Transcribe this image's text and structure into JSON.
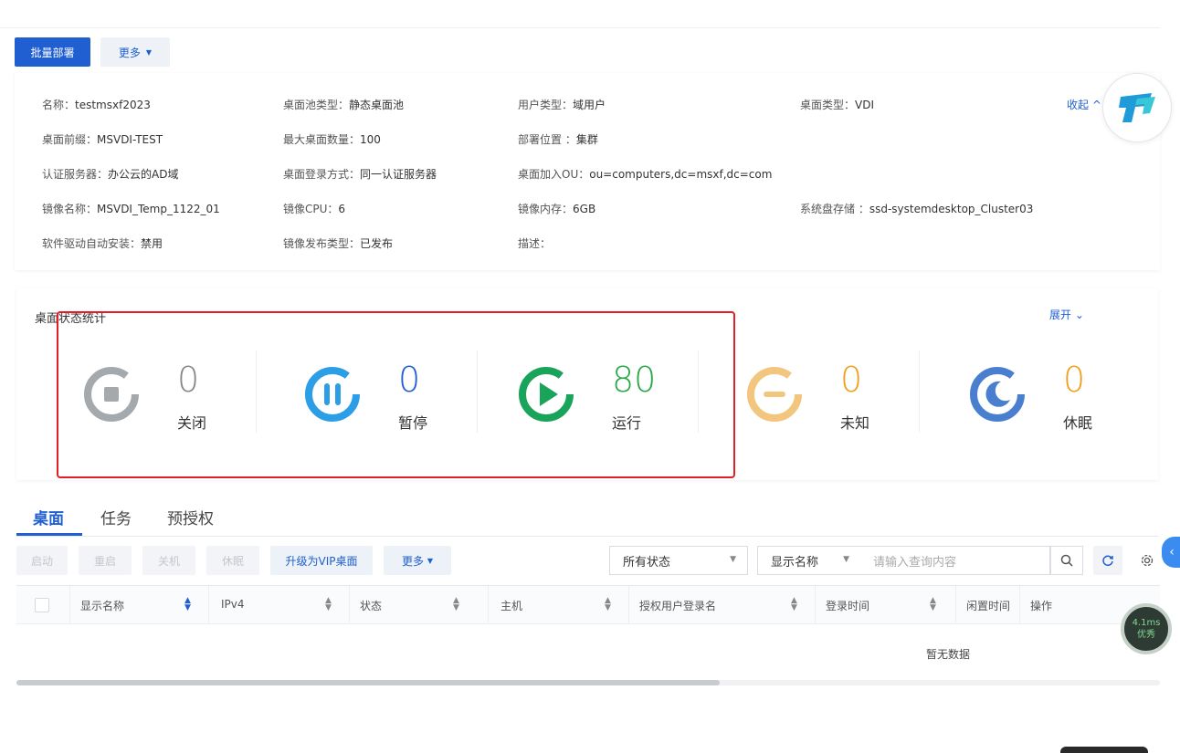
{
  "toolbar": {
    "batch_deploy": "批量部署",
    "more": "更多"
  },
  "info": {
    "collapse": "收起",
    "items": [
      {
        "label": "名称：",
        "value": "testmsxf2023"
      },
      {
        "label": "桌面池类型：",
        "value": "静态桌面池"
      },
      {
        "label": "用户类型：",
        "value": "域用户"
      },
      {
        "label": "桌面类型：",
        "value": "VDI"
      },
      {
        "label": "桌面前缀：",
        "value": "MSVDI-TEST"
      },
      {
        "label": "最大桌面数量：",
        "value": "100"
      },
      {
        "label": "部署位置 ：",
        "value": "集群"
      },
      {
        "label": "认证服务器：",
        "value": "办公云的AD域"
      },
      {
        "label": "桌面登录方式：",
        "value": "同一认证服务器"
      },
      {
        "label": "桌面加入OU：",
        "value": "ou=computers,dc=msxf,dc=com"
      },
      {
        "label": "镜像名称：",
        "value": "MSVDI_Temp_1122_01"
      },
      {
        "label": "镜像CPU：",
        "value": "6"
      },
      {
        "label": "镜像内存：",
        "value": "6GB"
      },
      {
        "label": "系统盘存储 ：",
        "value": "ssd-systemdesktop_Cluster03"
      },
      {
        "label": "软件驱动自动安装：",
        "value": "禁用"
      },
      {
        "label": "镜像发布类型：",
        "value": "已发布"
      },
      {
        "label": "描述：",
        "value": ""
      }
    ]
  },
  "stats": {
    "title": "桌面状态统计",
    "expand": "展开",
    "items": [
      {
        "count": "0",
        "label": "关闭",
        "color": "#a4a9ad",
        "num_color": "#888888"
      },
      {
        "count": "0",
        "label": "暂停",
        "color": "#2b9ee6",
        "num_color": "#1f5fd1"
      },
      {
        "count": "80",
        "label": "运行",
        "color": "#1aa35a",
        "num_color": "#2aa84a"
      },
      {
        "count": "0",
        "label": "未知",
        "color": "#f3c680",
        "num_color": "#f0a020"
      },
      {
        "count": "0",
        "label": "休眠",
        "color": "#4a7fd0",
        "num_color": "#f0a020"
      }
    ]
  },
  "tabs": [
    "桌面",
    "任务",
    "预授权"
  ],
  "actions": {
    "start": "启动",
    "restart": "重启",
    "shutdown": "关机",
    "sleep": "休眠",
    "upgrade_vip": "升级为VIP桌面",
    "more": "更多"
  },
  "filters": {
    "status": "所有状态",
    "field": "显示名称",
    "search_placeholder": "请输入查询内容"
  },
  "table": {
    "columns": [
      "显示名称",
      "IPv4",
      "状态",
      "主机",
      "授权用户登录名",
      "登录时间",
      "闲置时间",
      "操作"
    ],
    "empty": "暂无数据"
  },
  "perf_badge": {
    "time": "4.1ms",
    "label": "优秀"
  }
}
